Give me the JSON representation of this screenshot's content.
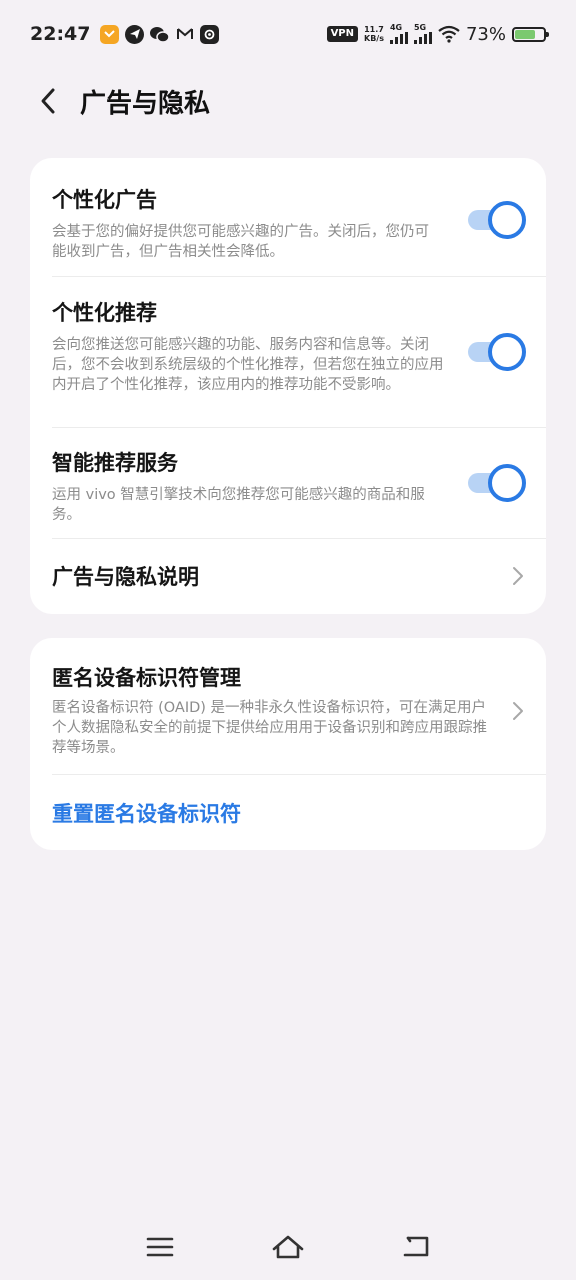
{
  "status_bar": {
    "time": "22:47",
    "vpn": "VPN",
    "speed_value": "11.7",
    "speed_unit": "KB/s",
    "sig1_label": "4G",
    "sig2_label": "5G",
    "battery_text": "73%",
    "battery_level": 0.73,
    "notification_icons": [
      "orange-app-icon",
      "telegram-icon",
      "wechat-icon",
      "gmail-icon",
      "game-icon"
    ]
  },
  "header": {
    "title": "广告与隐私"
  },
  "card1": {
    "personalized_ads": {
      "title": "个性化广告",
      "desc": "会基于您的偏好提供您可能感兴趣的广告。关闭后，您仍可能收到广告，但广告相关性会降低。",
      "enabled": true
    },
    "personalized_recommend": {
      "title": "个性化推荐",
      "desc": "会向您推送您可能感兴趣的功能、服务内容和信息等。关闭后，您不会收到系统层级的个性化推荐，但若您在独立的应用内开启了个性化推荐，该应用内的推荐功能不受影响。",
      "enabled": true
    },
    "smart_recommend": {
      "title": "智能推荐服务",
      "desc": "运用 vivo 智慧引擎技术向您推荐您可能感兴趣的商品和服务。",
      "enabled": true
    },
    "privacy_note": {
      "title": "广告与隐私说明"
    }
  },
  "card2": {
    "oaid": {
      "title": "匿名设备标识符管理",
      "desc": "匿名设备标识符 (OAID) 是一种非永久性设备标识符，可在满足用户个人数据隐私安全的前提下提供给应用用于设备识别和跨应用跟踪推荐等场景。"
    },
    "reset": {
      "label": "重置匿名设备标识符"
    }
  },
  "colors": {
    "accent": "#2a7ae4",
    "toggle_track": "#b8d3f5",
    "background": "#f4f1f5",
    "card": "#ffffff"
  }
}
